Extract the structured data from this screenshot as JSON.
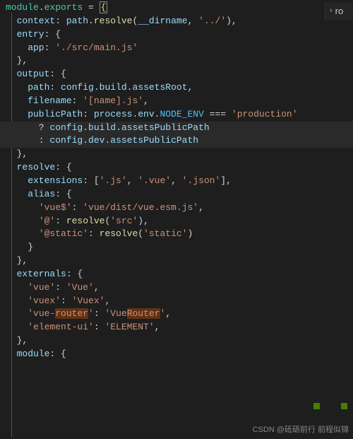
{
  "side_panel": {
    "label": "ro"
  },
  "watermark": "CSDN @砥砺前行 前程似锦",
  "code": {
    "l1": {
      "a": "module",
      "b": ".",
      "c": "exports",
      "d": " = ",
      "e": "{"
    },
    "l2": {
      "a": "  context",
      "b": ": ",
      "c": "path",
      "d": ".",
      "e": "resolve",
      "f": "(",
      "g": "__dirname",
      "h": ", ",
      "i": "'../'",
      "j": "),"
    },
    "l3": {
      "a": "  entry",
      "b": ": {"
    },
    "l4": {
      "a": "    app",
      "b": ": ",
      "c": "'./src/main.js'"
    },
    "l5": {
      "a": "  },"
    },
    "l6": {
      "a": "  output",
      "b": ": {"
    },
    "l7": {
      "a": "    path",
      "b": ": ",
      "c": "config",
      "d": ".",
      "e": "build",
      "f": ".",
      "g": "assetsRoot",
      "h": ","
    },
    "l8": {
      "a": "    filename",
      "b": ": ",
      "c": "'[name].js'",
      "d": ","
    },
    "l9": {
      "a": "    publicPath",
      "b": ": ",
      "c": "process",
      "d": ".",
      "e": "env",
      "f": ".",
      "g": "NODE_ENV",
      "h": " === ",
      "i": "'production'"
    },
    "l10": {
      "a": "      ? ",
      "b": "config",
      "c": ".",
      "d": "build",
      "e": ".",
      "f": "assetsPublicPath"
    },
    "l11": {
      "a": "      : ",
      "b": "config",
      "c": ".",
      "d": "dev",
      "e": ".",
      "f": "assetsPublicPath"
    },
    "l12": {
      "a": "  },"
    },
    "l13": {
      "a": "  resolve",
      "b": ": {"
    },
    "l14": {
      "a": "    extensions",
      "b": ": [",
      "c": "'.js'",
      "d": ", ",
      "e": "'.vue'",
      "f": ", ",
      "g": "'.json'",
      "h": "],"
    },
    "l15": {
      "a": "    alias",
      "b": ": {"
    },
    "l16": {
      "a": "      ",
      "b": "'vue$'",
      "c": ": ",
      "d": "'vue/dist/vue.esm.js'",
      "e": ","
    },
    "l17": {
      "a": "      ",
      "b": "'@'",
      "c": ": ",
      "d": "resolve",
      "e": "(",
      "f": "'src'",
      "g": "),"
    },
    "l18": {
      "a": "      ",
      "b": "'@static'",
      "c": ": ",
      "d": "resolve",
      "e": "(",
      "f": "'static'",
      "g": ")"
    },
    "l19": {
      "a": "    }"
    },
    "l20": {
      "a": "  },"
    },
    "l21": {
      "a": "  externals",
      "b": ": {"
    },
    "l22": {
      "a": "    ",
      "b": "'vue'",
      "c": ": ",
      "d": "'Vue'",
      "e": ","
    },
    "l23": {
      "a": "    ",
      "b": "'vuex'",
      "c": ": ",
      "d": "'Vuex'",
      "e": ","
    },
    "l24": {
      "a": "    ",
      "b": "'vue-",
      "c": "router",
      "d": "'",
      "e": ": ",
      "f": "'Vue",
      "g": "Router",
      "h": "'",
      "i": ","
    },
    "l25": {
      "a": "    ",
      "b": "'element-ui'",
      "c": ": ",
      "d": "'ELEMENT'",
      "e": ","
    },
    "l26": {
      "a": "  },"
    },
    "l27": {
      "a": "  module",
      "b": ": {"
    }
  }
}
